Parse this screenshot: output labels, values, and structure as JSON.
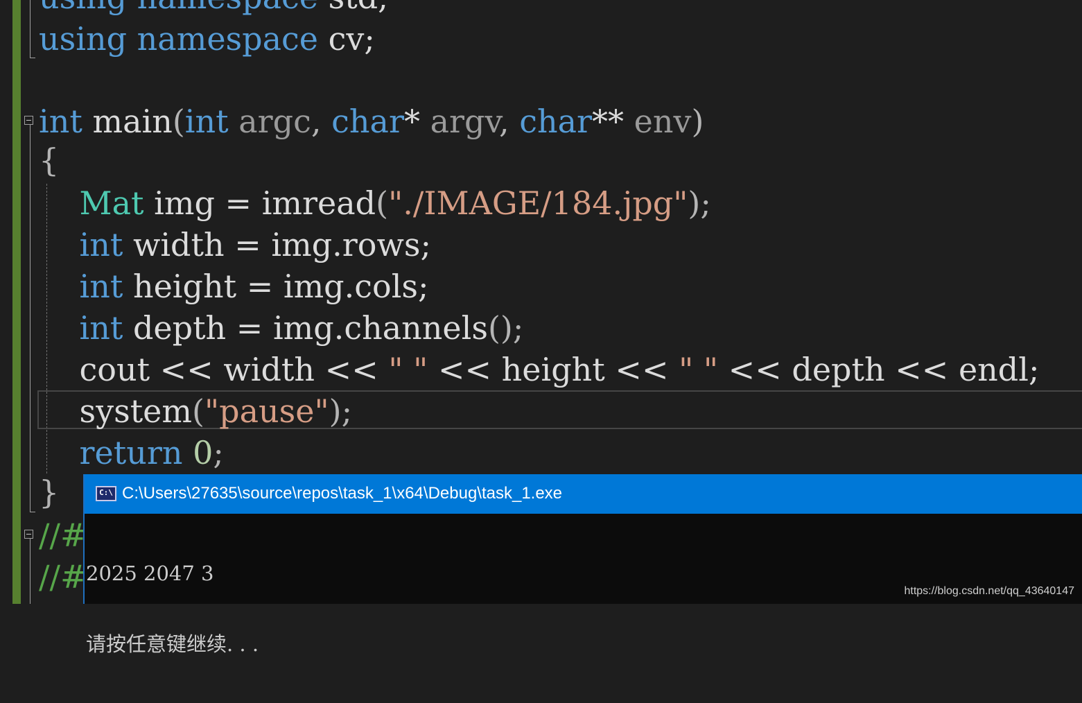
{
  "editor": {
    "lines": [
      {
        "id": "l0",
        "tokens": [
          {
            "t": "using",
            "c": "kw"
          },
          {
            "t": " "
          },
          {
            "t": "namespace",
            "c": "kw"
          },
          {
            "t": " std;"
          }
        ]
      },
      {
        "id": "l1",
        "tokens": [
          {
            "t": "using",
            "c": "kw"
          },
          {
            "t": " "
          },
          {
            "t": "namespace",
            "c": "kw"
          },
          {
            "t": " cv;"
          }
        ]
      },
      {
        "id": "l3",
        "tokens": [
          {
            "t": "int",
            "c": "kw"
          },
          {
            "t": " main"
          },
          {
            "t": "(",
            "c": "pn"
          },
          {
            "t": "int",
            "c": "kw"
          },
          {
            "t": " "
          },
          {
            "t": "argc",
            "c": "prm"
          },
          {
            "t": ", ",
            "c": "pn"
          },
          {
            "t": "char",
            "c": "kw"
          },
          {
            "t": "* "
          },
          {
            "t": "argv",
            "c": "prm"
          },
          {
            "t": ", ",
            "c": "pn"
          },
          {
            "t": "char",
            "c": "kw"
          },
          {
            "t": "** "
          },
          {
            "t": "env",
            "c": "prm"
          },
          {
            "t": ")",
            "c": "pn"
          }
        ]
      },
      {
        "id": "l4",
        "tokens": [
          {
            "t": "{",
            "c": "pn"
          }
        ]
      },
      {
        "id": "l5",
        "tokens": [
          {
            "t": "    "
          },
          {
            "t": "Mat",
            "c": "ty"
          },
          {
            "t": " img = imread"
          },
          {
            "t": "(",
            "c": "pn"
          },
          {
            "t": "\"./IMAGE/184.jpg\"",
            "c": "str"
          },
          {
            "t": ");",
            "c": "pn"
          }
        ]
      },
      {
        "id": "l6",
        "tokens": [
          {
            "t": "    "
          },
          {
            "t": "int",
            "c": "kw"
          },
          {
            "t": " width = img.rows;"
          }
        ]
      },
      {
        "id": "l7",
        "tokens": [
          {
            "t": "    "
          },
          {
            "t": "int",
            "c": "kw"
          },
          {
            "t": " height = img.cols;"
          }
        ]
      },
      {
        "id": "l8",
        "tokens": [
          {
            "t": "    "
          },
          {
            "t": "int",
            "c": "kw"
          },
          {
            "t": " depth = img.channels"
          },
          {
            "t": "();",
            "c": "pn"
          }
        ]
      },
      {
        "id": "l9",
        "tokens": [
          {
            "t": "    cout << width << "
          },
          {
            "t": "\" \"",
            "c": "str"
          },
          {
            "t": " << height << "
          },
          {
            "t": "\" \"",
            "c": "str"
          },
          {
            "t": " << depth << endl;"
          }
        ]
      },
      {
        "id": "l10",
        "tokens": [
          {
            "t": "    system"
          },
          {
            "t": "(",
            "c": "pn"
          },
          {
            "t": "\"pause\"",
            "c": "str"
          },
          {
            "t": ");",
            "c": "pn"
          }
        ]
      },
      {
        "id": "l11",
        "tokens": [
          {
            "t": "    "
          },
          {
            "t": "return",
            "c": "kw"
          },
          {
            "t": " "
          },
          {
            "t": "0",
            "c": "num"
          },
          {
            "t": ";",
            "c": "pn"
          }
        ]
      },
      {
        "id": "l12",
        "tokens": [
          {
            "t": "}",
            "c": "pn"
          }
        ]
      },
      {
        "id": "l13",
        "tokens": [
          {
            "t": "//#",
            "c": "cm"
          }
        ]
      },
      {
        "id": "l14",
        "tokens": [
          {
            "t": "//#",
            "c": "cm"
          }
        ]
      }
    ]
  },
  "console": {
    "title": "C:\\Users\\27635\\source\\repos\\task_1\\x64\\Debug\\task_1.exe",
    "icon": "console-app-icon",
    "icon_text": "C:\\",
    "output": [
      "2025 2047 3",
      "请按任意键继续. . ."
    ]
  },
  "watermark": "https://blog.csdn.net/qq_43640147"
}
